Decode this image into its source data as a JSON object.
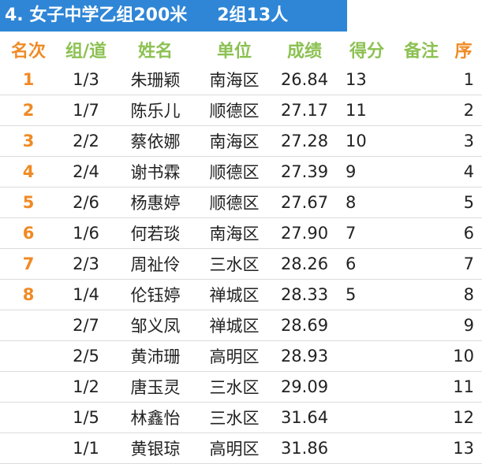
{
  "title": {
    "event": "4. 女子中学乙组200米",
    "groups": "2组13人"
  },
  "headers": [
    "名次",
    "组/道",
    "姓名",
    "单位",
    "成绩",
    "得分",
    "备注",
    "序"
  ],
  "rows": [
    {
      "rank": "1",
      "lane": "1/3",
      "name": "朱珊颖",
      "unit": "南海区",
      "time": "26.84",
      "points": "13",
      "note": "",
      "seq": "1"
    },
    {
      "rank": "2",
      "lane": "1/7",
      "name": "陈乐儿",
      "unit": "顺德区",
      "time": "27.17",
      "points": "11",
      "note": "",
      "seq": "2"
    },
    {
      "rank": "3",
      "lane": "2/2",
      "name": "蔡依娜",
      "unit": "南海区",
      "time": "27.28",
      "points": "10",
      "note": "",
      "seq": "3"
    },
    {
      "rank": "4",
      "lane": "2/4",
      "name": "谢书霖",
      "unit": "顺德区",
      "time": "27.39",
      "points": "9",
      "note": "",
      "seq": "4"
    },
    {
      "rank": "5",
      "lane": "2/6",
      "name": "杨惠婷",
      "unit": "顺德区",
      "time": "27.67",
      "points": "8",
      "note": "",
      "seq": "5"
    },
    {
      "rank": "6",
      "lane": "1/6",
      "name": "何若琰",
      "unit": "南海区",
      "time": "27.90",
      "points": "7",
      "note": "",
      "seq": "6"
    },
    {
      "rank": "7",
      "lane": "2/3",
      "name": "周祉伶",
      "unit": "三水区",
      "time": "28.26",
      "points": "6",
      "note": "",
      "seq": "7"
    },
    {
      "rank": "8",
      "lane": "1/4",
      "name": "伦钰婷",
      "unit": "禅城区",
      "time": "28.33",
      "points": "5",
      "note": "",
      "seq": "8"
    },
    {
      "rank": "",
      "lane": "2/7",
      "name": "邹义凤",
      "unit": "禅城区",
      "time": "28.69",
      "points": "",
      "note": "",
      "seq": "9"
    },
    {
      "rank": "",
      "lane": "2/5",
      "name": "黄沛珊",
      "unit": "高明区",
      "time": "28.93",
      "points": "",
      "note": "",
      "seq": "10"
    },
    {
      "rank": "",
      "lane": "1/2",
      "name": "唐玉灵",
      "unit": "三水区",
      "time": "29.09",
      "points": "",
      "note": "",
      "seq": "11"
    },
    {
      "rank": "",
      "lane": "1/5",
      "name": "林鑫怡",
      "unit": "三水区",
      "time": "31.64",
      "points": "",
      "note": "",
      "seq": "12"
    },
    {
      "rank": "",
      "lane": "1/1",
      "name": "黄银琼",
      "unit": "高明区",
      "time": "31.86",
      "points": "",
      "note": "",
      "seq": "13"
    }
  ]
}
